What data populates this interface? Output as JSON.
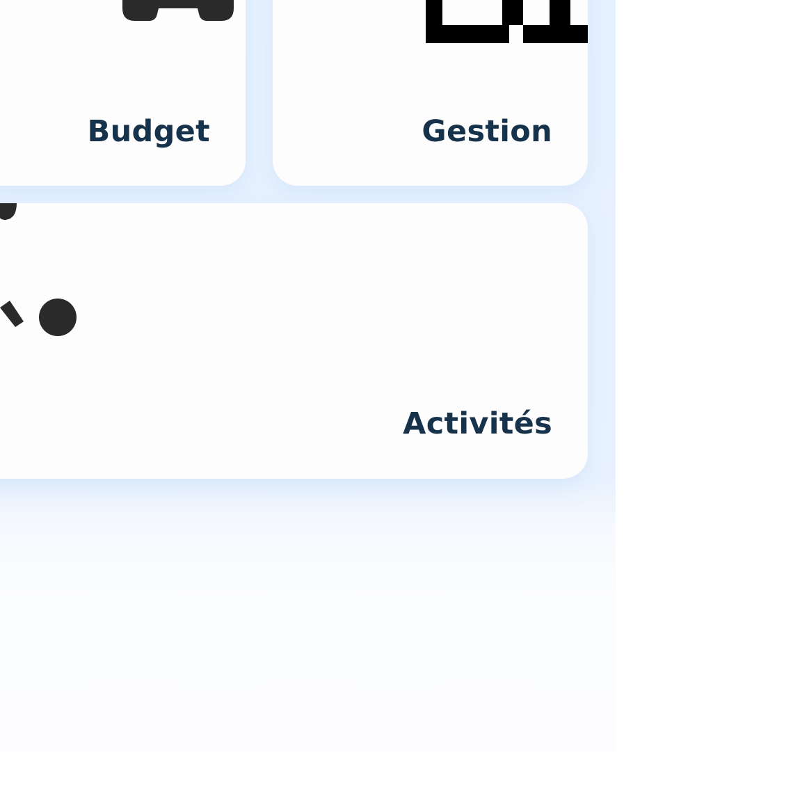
{
  "tiles": {
    "budget": {
      "label": "Budget",
      "icon": "budget-icon"
    },
    "gestion": {
      "label": "Gestion",
      "icon": "building-icon"
    },
    "activites": {
      "label": "Activités",
      "icon": "activity-icon"
    }
  },
  "colors": {
    "label_text": "#17324b",
    "tile_background": "#fdfdfd",
    "panel_background": "#e6f1fe",
    "icon_fill": "#2a2a2a"
  }
}
